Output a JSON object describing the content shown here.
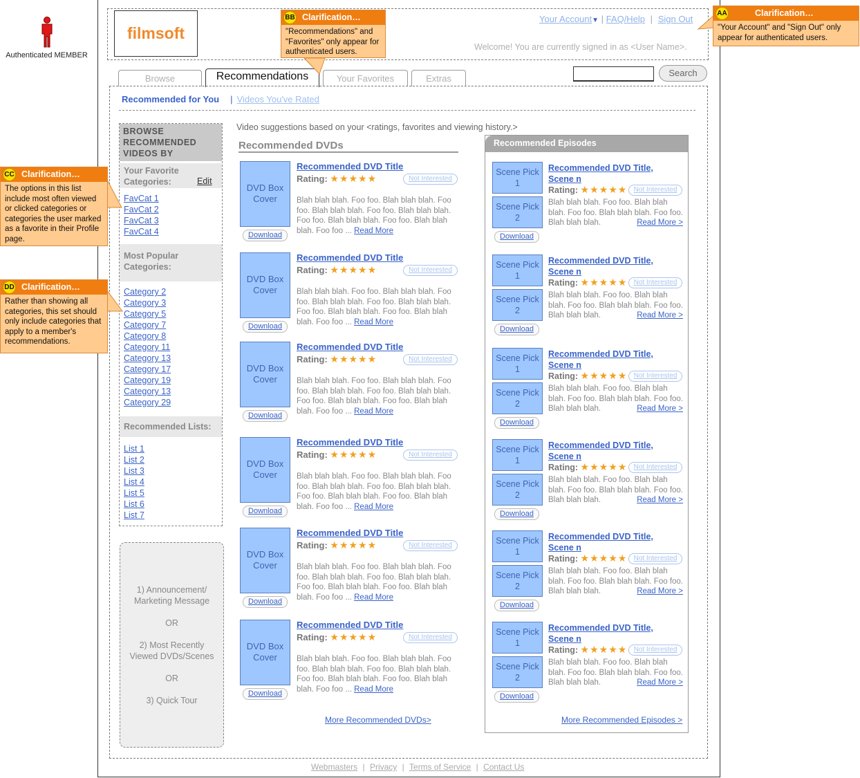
{
  "member": {
    "label": "Authenticated MEMBER"
  },
  "logo": "filmsoft",
  "top_links": {
    "account": "Your Account",
    "faq": "FAQ/Help",
    "signout": "Sign Out",
    "sep": "|"
  },
  "welcome": "Welcome! You are currently signed in as <User Name>.",
  "tabs": [
    "Browse",
    "Recommendations",
    "Your Favorites",
    "Extras"
  ],
  "search": {
    "button": "Search",
    "value": ""
  },
  "subnav": {
    "active": "Recommended for You",
    "sep": "|",
    "other": "Videos You've Rated"
  },
  "sidebar": {
    "heading": "BROWSE RECOMMENDED VIDEOS BY",
    "fav_title": "Your Favorite Categories:",
    "fav_edit": "Edit",
    "favs": [
      "FavCat 1",
      "FavCat 2",
      "FavCat 3",
      "FavCat 4"
    ],
    "pop_title": "Most Popular Categories:",
    "popular": [
      "Category 2",
      "Category 3",
      "Category 5",
      "Category 7",
      "Category 8",
      "Category 11",
      "Category 13",
      "Category 17",
      "Category 19",
      "Category 13",
      "Category 29"
    ],
    "lists_title": "Recommended Lists:",
    "lists": [
      "List 1",
      "List 2",
      "List 3",
      "List 4",
      "List 5",
      "List 6",
      "List 7"
    ]
  },
  "promo": {
    "line1": "1) Announcement/ Marketing Message",
    "or1": "OR",
    "line2": "2) Most Recently Viewed DVDs/Scenes",
    "or2": "OR",
    "line3": "3) Quick Tour"
  },
  "intro": "Video suggestions based on your <ratings, favorites and viewing history.>",
  "dvds": {
    "heading": "Recommended DVDs",
    "cover": "DVD Box Cover",
    "download": "Download",
    "title": "Recommended DVD Title",
    "rating_label": "Rating:",
    "stars": "★★★★★",
    "not_interested": "Not Interested",
    "blurb": "Blah blah blah. Foo foo. Blah blah blah. Foo foo. Blah blah blah. Foo foo. Blah blah blah. Foo foo. Blah blah blah. Foo foo.  Blah blah blah. Foo foo ...",
    "read_more": "Read More",
    "more": "More Recommended DVDs>"
  },
  "episodes": {
    "heading": "Recommended Episodes",
    "scene1": "Scene Pick 1",
    "scene2": "Scene Pick 2",
    "download": "Download",
    "title": "Recommended DVD Title, Scene n",
    "rating_label": "Rating:",
    "stars": "★★★★★",
    "not_interested": "Not Interested",
    "blurb": "Blah blah blah. Foo foo. Blah blah blah. Foo foo. Blah blah blah. Foo foo. Blah blah blah.",
    "read_more": "Read More >",
    "more": "More Recommended Episodes >"
  },
  "footer": {
    "links": [
      "Webmasters",
      "Privacy",
      "Terms of Service",
      "Contact Us"
    ],
    "sep": "|"
  },
  "callouts": {
    "aa": {
      "badge": "AA",
      "title": "Clarification…",
      "text": "\"Your Account\" and \"Sign Out\" only appear for authenticated users."
    },
    "bb": {
      "badge": "BB",
      "title": "Clarification…",
      "text": "\"Recommendations\" and \"Favorites\" only appear for authenticated users."
    },
    "cc": {
      "badge": "CC",
      "title": "Clarification…",
      "text": "The options in this list include most often viewed or clicked categories or categories the user marked as a favorite in their Profile page."
    },
    "dd": {
      "badge": "DD",
      "title": "Clarification…",
      "text": "Rather than showing all categories, this set should only include categories that apply to a member's recommendations."
    }
  },
  "colors": {
    "accent_blue": "#3a63c8",
    "cover_blue": "#9ec7ff",
    "callout_orange": "#f07d10",
    "callout_body": "#ffcb8e",
    "logo_orange": "#f08a2c",
    "star": "#f0a020"
  }
}
